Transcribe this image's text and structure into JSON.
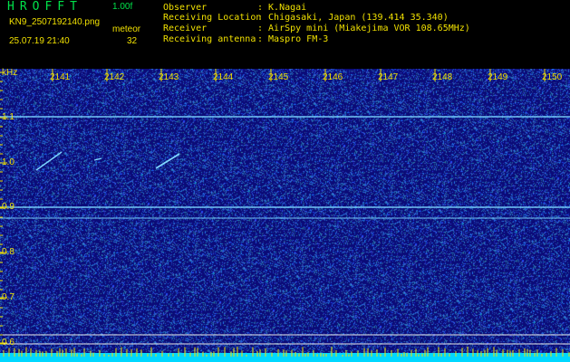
{
  "app": {
    "title": "HROFFT",
    "version": "1.00f"
  },
  "file": {
    "name": "KN9_2507192140.png",
    "datetime": "25.07.19 21:40"
  },
  "meteor": {
    "label": "meteor",
    "count": "32"
  },
  "info": [
    {
      "label": "Observer",
      "value": ": K.Nagai"
    },
    {
      "label": "Receiving Location",
      "value": ": Chigasaki, Japan (139.414 35.340)"
    },
    {
      "label": "Receiver",
      "value": ": AirSpy mini (Miakejima VOR 108.65MHz)"
    },
    {
      "label": "Receiving antenna",
      "value": ": Maspro FM-3"
    }
  ],
  "yaxis": {
    "unit": "kHz",
    "ticks": [
      "1.1",
      "1.0",
      "0.9",
      "0.8",
      "0.7",
      "0.6"
    ]
  },
  "xaxis": {
    "ticks": [
      "2141",
      "2142",
      "2143",
      "2144",
      "2145",
      "2146",
      "2147",
      "2148",
      "2149",
      "2150"
    ]
  },
  "colors": {
    "background": "#0b0b78",
    "noise": "#2a6cff",
    "line": "#7fd8ff",
    "text": "#f0e000",
    "title": "#00e24a",
    "baseline": "#00d8ff"
  }
}
